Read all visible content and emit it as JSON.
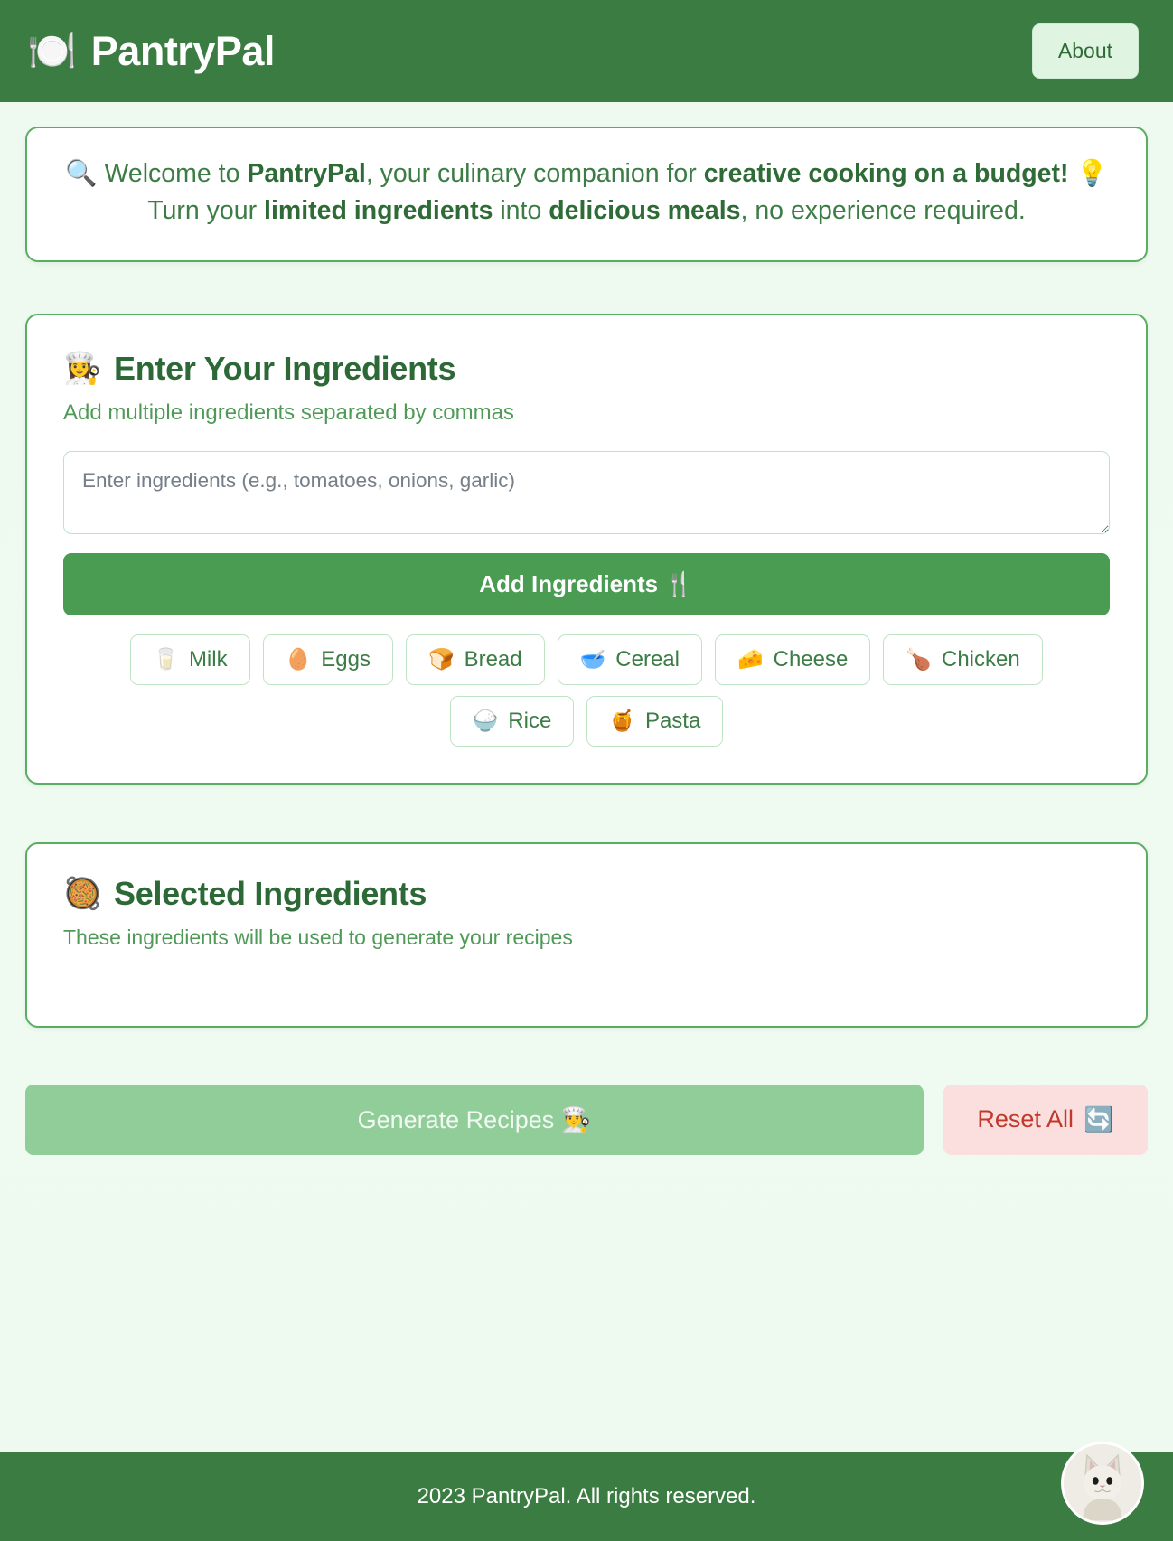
{
  "header": {
    "logo_icon": "fork-knife-plate-icon",
    "logo_glyph": "🍽️",
    "brand": "PantryPal",
    "about_label": "About"
  },
  "welcome": {
    "search_glyph": "🔍",
    "bulb_glyph": "💡",
    "part1": "Welcome to ",
    "brand_bold": "PantryPal",
    "part2": ", your culinary companion for ",
    "bold1": "creative cooking on a budget!",
    "part3": " Turn your ",
    "bold2": "limited ingredients",
    "part4": " into ",
    "bold3": "delicious meals",
    "part5": ", no experience required."
  },
  "ingredients_section": {
    "title": "Enter Your Ingredients",
    "title_glyph": "👩‍🍳",
    "subtitle": "Add multiple ingredients separated by commas",
    "textarea_placeholder": "Enter ingredients (e.g., tomatoes, onions, garlic)",
    "textarea_value": "",
    "add_button_label": "Add Ingredients",
    "add_button_glyph": "🍴",
    "quick_chips": [
      {
        "label": "Milk",
        "glyph": "🥛",
        "icon": "milk-glass-icon"
      },
      {
        "label": "Eggs",
        "glyph": "🥚",
        "icon": "egg-icon"
      },
      {
        "label": "Bread",
        "glyph": "🍞",
        "icon": "bread-icon"
      },
      {
        "label": "Cereal",
        "glyph": "🥣",
        "icon": "bowl-spoon-icon"
      },
      {
        "label": "Cheese",
        "glyph": "🧀",
        "icon": "cheese-icon"
      },
      {
        "label": "Chicken",
        "glyph": "🍗",
        "icon": "poultry-leg-icon"
      },
      {
        "label": "Rice",
        "glyph": "🍚",
        "icon": "rice-bowl-icon"
      },
      {
        "label": "Pasta",
        "glyph": "🍯",
        "icon": "honey-pot-icon"
      }
    ]
  },
  "selected_section": {
    "title": "Selected Ingredients",
    "title_glyph": "🥘",
    "subtitle": "These ingredients will be used to generate your recipes",
    "items": []
  },
  "actions": {
    "generate_label": "Generate Recipes",
    "generate_glyph": "👨‍🍳",
    "generate_disabled": true,
    "reset_label": "Reset All",
    "reset_glyph": "🔄"
  },
  "footer": {
    "copyright": "2023 PantryPal. All rights reserved.",
    "avatar_icon": "cat-avatar-icon"
  },
  "colors": {
    "brand_green": "#3b7c42",
    "accent_green": "#4a9c52",
    "card_border": "#5aad63",
    "page_bg": "#eef9f0",
    "danger_red": "#c0392b",
    "danger_bg": "#fbdede"
  }
}
